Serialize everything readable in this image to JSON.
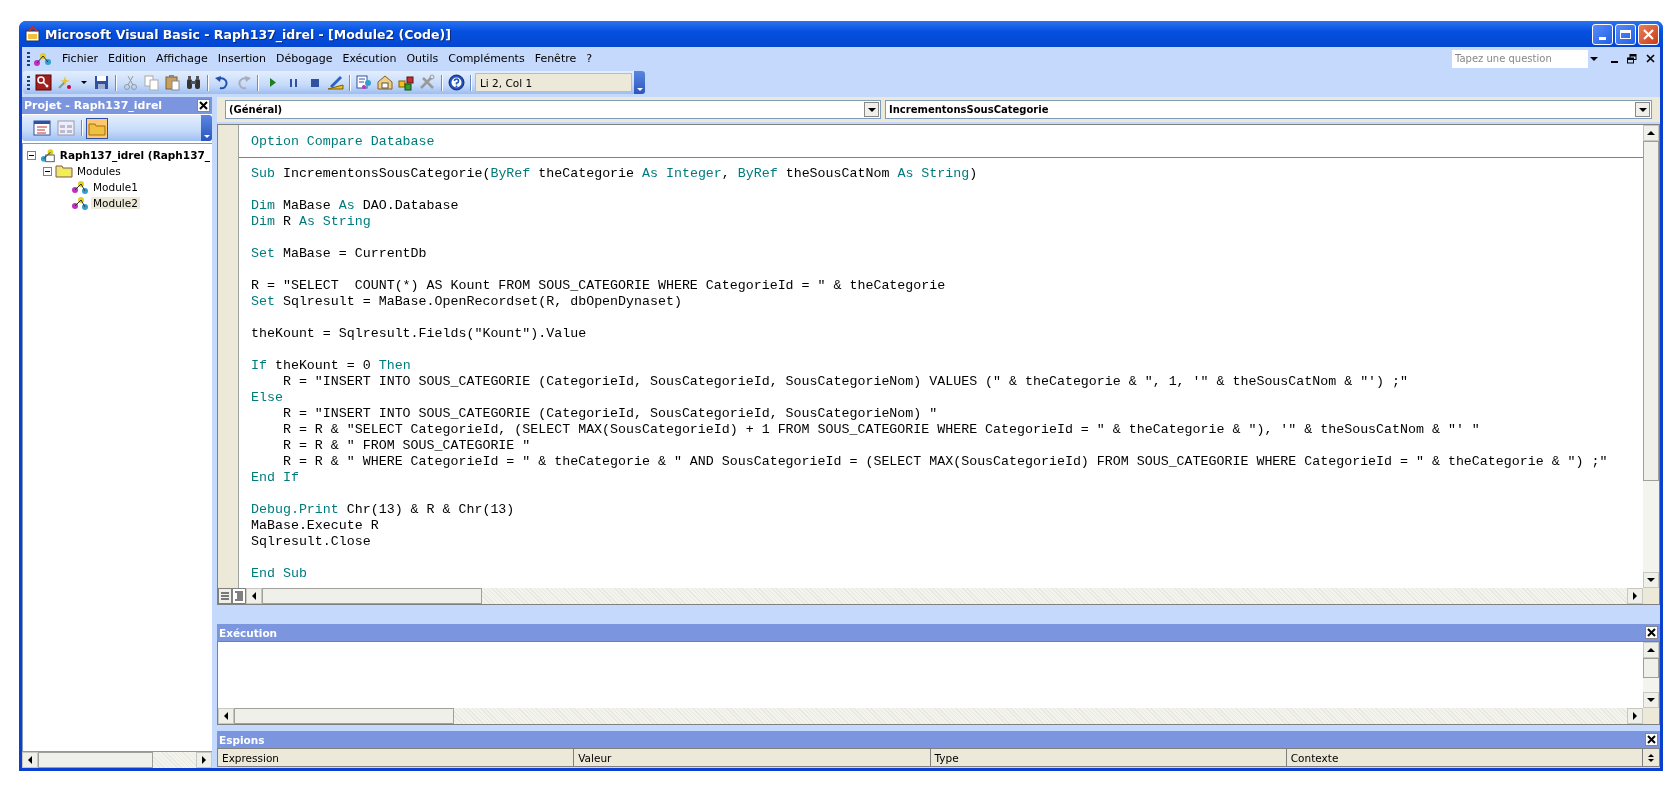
{
  "window": {
    "title": "Microsoft Visual Basic - Raph137_idrel - [Module2 (Code)]"
  },
  "menu": [
    "Fichier",
    "Edition",
    "Affichage",
    "Insertion",
    "Débogage",
    "Exécution",
    "Outils",
    "Compléments",
    "Fenêtre",
    "?"
  ],
  "help_box": {
    "placeholder": "Tapez une question"
  },
  "toolbar": {
    "position": "Li 2, Col 1"
  },
  "project_panel": {
    "title": "Projet - Raph137_idrel",
    "tree": [
      {
        "label": "Raph137_idrel (Raph137_",
        "expanded": true,
        "selected": false,
        "children": [
          {
            "label": "Modules",
            "expanded": true,
            "selected": false,
            "children": [
              {
                "label": "Module1",
                "selected": false
              },
              {
                "label": "Module2",
                "selected": true
              }
            ]
          }
        ]
      }
    ]
  },
  "code_window": {
    "object_combo": "(Général)",
    "procedure_combo": "IncrementonsSousCategorie",
    "blocks": [
      [
        [
          {
            "text": "Option Compare Database",
            "kind": "keyword"
          }
        ]
      ],
      [
        [
          {
            "text": "Sub",
            "kind": "keyword"
          },
          {
            "text": " IncrementonsSousCategorie(",
            "kind": "plain"
          },
          {
            "text": "ByRef",
            "kind": "keyword"
          },
          {
            "text": " theCategorie ",
            "kind": "plain"
          },
          {
            "text": "As Integer",
            "kind": "keyword"
          },
          {
            "text": ", ",
            "kind": "plain"
          },
          {
            "text": "ByRef",
            "kind": "keyword"
          },
          {
            "text": " theSousCatNom ",
            "kind": "plain"
          },
          {
            "text": "As String",
            "kind": "keyword"
          },
          {
            "text": ")",
            "kind": "plain"
          }
        ]
      ],
      [
        [
          {
            "text": "Dim",
            "kind": "keyword"
          },
          {
            "text": " MaBase ",
            "kind": "plain"
          },
          {
            "text": "As",
            "kind": "keyword"
          },
          {
            "text": " DAO.Database",
            "kind": "plain"
          }
        ],
        [
          {
            "text": "Dim",
            "kind": "keyword"
          },
          {
            "text": " R ",
            "kind": "plain"
          },
          {
            "text": "As String",
            "kind": "keyword"
          }
        ]
      ],
      [
        [
          {
            "text": "Set",
            "kind": "keyword"
          },
          {
            "text": " MaBase = CurrentDb",
            "kind": "plain"
          }
        ]
      ],
      [
        [
          {
            "text": "R = \"SELECT  COUNT(*) AS Kount FROM SOUS_CATEGORIE WHERE CategorieId = \" & theCategorie",
            "kind": "plain"
          }
        ],
        [
          {
            "text": "Set",
            "kind": "keyword"
          },
          {
            "text": " Sqlresult = MaBase.OpenRecordset(R, dbOpenDynaset)",
            "kind": "plain"
          }
        ]
      ],
      [
        [
          {
            "text": "theKount = Sqlresult.Fields(\"Kount\").Value",
            "kind": "plain"
          }
        ]
      ],
      [
        [
          {
            "text": "If",
            "kind": "keyword"
          },
          {
            "text": " theKount = 0 ",
            "kind": "plain"
          },
          {
            "text": "Then",
            "kind": "keyword"
          }
        ],
        [
          {
            "text": "    R = \"INSERT INTO SOUS_CATEGORIE (CategorieId, SousCategorieId, SousCategorieNom) VALUES (\" & theCategorie & \", 1, '\" & theSousCatNom & \"') ;\"",
            "kind": "plain"
          }
        ],
        [
          {
            "text": "Else",
            "kind": "keyword"
          }
        ],
        [
          {
            "text": "    R = \"INSERT INTO SOUS_CATEGORIE (CategorieId, SousCategorieId, SousCategorieNom) \"",
            "kind": "plain"
          }
        ],
        [
          {
            "text": "    R = R & \"SELECT CategorieId, (SELECT MAX(SousCategorieId) + 1 FROM SOUS_CATEGORIE WHERE CategorieId = \" & theCategorie & \"), '\" & theSousCatNom & \"' \"",
            "kind": "plain"
          }
        ],
        [
          {
            "text": "    R = R & \" FROM SOUS_CATEGORIE \"",
            "kind": "plain"
          }
        ],
        [
          {
            "text": "    R = R & \" WHERE CategorieId = \" & theCategorie & \" AND SousCategorieId = (SELECT MAX(SousCategorieId) FROM SOUS_CATEGORIE WHERE CategorieId = \" & theCategorie & \") ;\"",
            "kind": "plain"
          }
        ],
        [
          {
            "text": "End If",
            "kind": "keyword"
          }
        ]
      ],
      [
        [
          {
            "text": "Debug.Print",
            "kind": "keyword"
          },
          {
            "text": " Chr(13) & R & Chr(13)",
            "kind": "plain"
          }
        ],
        [
          {
            "text": "MaBase.Execute R",
            "kind": "plain"
          }
        ],
        [
          {
            "text": "Sqlresult.Close",
            "kind": "plain"
          }
        ]
      ],
      [
        [
          {
            "text": "End Sub",
            "kind": "keyword"
          }
        ]
      ]
    ]
  },
  "immediate_panel": {
    "title": "Exécution"
  },
  "watch_panel": {
    "title": "Espions",
    "columns": [
      "Expression",
      "Valeur",
      "Type",
      "Contexte"
    ]
  }
}
